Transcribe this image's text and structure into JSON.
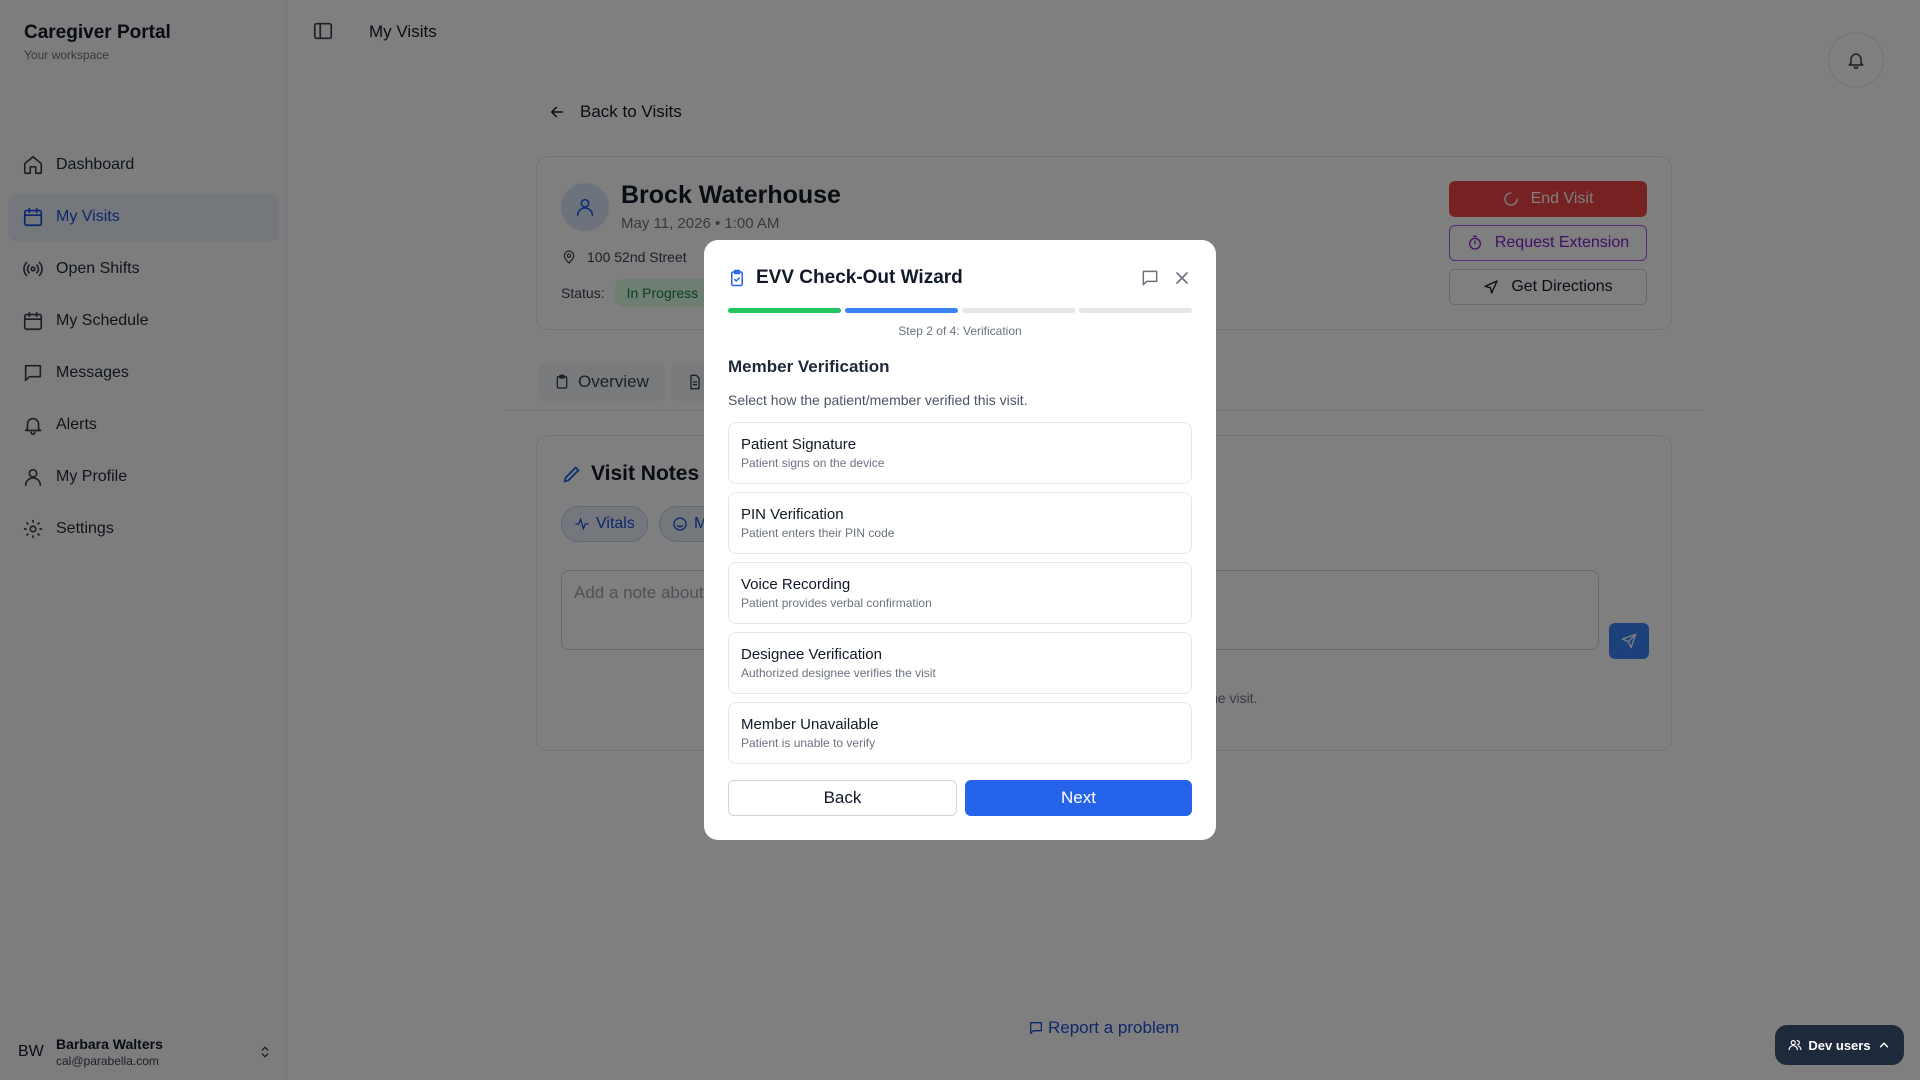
{
  "brand": {
    "title": "Caregiver Portal",
    "subtitle": "Your workspace"
  },
  "nav": [
    {
      "label": "Dashboard",
      "icon": "home-icon"
    },
    {
      "label": "My Visits",
      "icon": "calendar-icon",
      "active": true
    },
    {
      "label": "Open Shifts",
      "icon": "broadcast-icon"
    },
    {
      "label": "My Schedule",
      "icon": "calendar-icon"
    },
    {
      "label": "Messages",
      "icon": "message-icon"
    },
    {
      "label": "Alerts",
      "icon": "bell-icon"
    },
    {
      "label": "My Profile",
      "icon": "user-icon"
    },
    {
      "label": "Settings",
      "icon": "gear-icon"
    }
  ],
  "user": {
    "initials": "BW",
    "name": "Barbara Walters",
    "email": "cal@parabella.com"
  },
  "header": {
    "title": "My Visits"
  },
  "back": {
    "label": "Back to Visits"
  },
  "visit": {
    "patient": "Brock Waterhouse",
    "datetime": "May 11, 2026 • 1:00 AM",
    "address": "100 52nd Street",
    "status_label": "Status:",
    "status": "In Progress",
    "end_label": "End Visit",
    "extension_label": "Request Extension",
    "directions_label": "Get Directions"
  },
  "tabs": [
    {
      "label": "Overview"
    },
    {
      "label": ""
    }
  ],
  "notes": {
    "title": "Visit Notes",
    "chips": [
      "Vitals",
      "M"
    ],
    "placeholder": "Add a note about",
    "empty_fragment": "he visit."
  },
  "report": {
    "label": "Report a problem"
  },
  "devusers": {
    "label": "Dev users"
  },
  "modal": {
    "title": "EVV Check-Out Wizard",
    "step_label": "Step 2 of 4: Verification",
    "progress": {
      "current_step": 2,
      "total_steps": 4
    },
    "section_title": "Member Verification",
    "description": "Select how the patient/member verified this visit.",
    "options": [
      {
        "title": "Patient Signature",
        "subtitle": "Patient signs on the device"
      },
      {
        "title": "PIN Verification",
        "subtitle": "Patient enters their PIN code"
      },
      {
        "title": "Voice Recording",
        "subtitle": "Patient provides verbal confirmation"
      },
      {
        "title": "Designee Verification",
        "subtitle": "Authorized designee verifies the visit"
      },
      {
        "title": "Member Unavailable",
        "subtitle": "Patient is unable to verify"
      }
    ],
    "back_label": "Back",
    "next_label": "Next"
  },
  "colors": {
    "accent": "#2563eb",
    "success": "#22c55e",
    "danger": "#ef4444",
    "purple": "#7e22ce"
  }
}
